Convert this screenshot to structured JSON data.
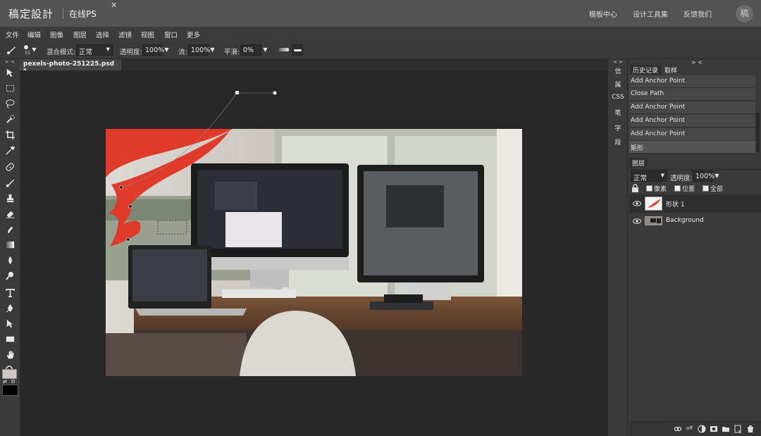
{
  "header": {
    "brand": "稿定設計",
    "product": "在线PS",
    "links": [
      "模板中心",
      "设计工具集",
      "反馈我们"
    ],
    "avatar_char": "稿"
  },
  "menu": [
    "文件",
    "编辑",
    "图像",
    "图层",
    "选择",
    "滤镜",
    "视图",
    "窗口",
    "更多"
  ],
  "options": {
    "brush_size": "15",
    "blend_label": "混合模式:",
    "blend_value": "正常",
    "opacity_label": "透明度:",
    "opacity_value": "100%",
    "flow_label": "流:",
    "flow_value": "100%",
    "smooth_label": "平滑:",
    "smooth_value": "0%"
  },
  "document": {
    "tab_label": "pexels-photo-251225.psd *",
    "close_glyph": "✕"
  },
  "side_strip": [
    "信",
    "属",
    "CSS",
    "笔",
    "字",
    "段"
  ],
  "panel_toggles": {
    "left": "> <",
    "strip": "< >",
    "right": "> <"
  },
  "history": {
    "tabs": [
      "历史记录",
      "取样"
    ],
    "items": [
      "Add Anchor Point",
      "Close Path",
      "Add Anchor Point",
      "Add Anchor Point",
      "Add Anchor Point",
      "矩形"
    ]
  },
  "layers": {
    "tab": "图层",
    "blend_value": "正常",
    "opacity_label": "透明度:",
    "opacity_value": "100%",
    "lock_options": [
      "像素",
      "位置",
      "全部"
    ],
    "items": [
      {
        "name": "形状 1",
        "selected": true
      },
      {
        "name": "Background",
        "selected": false
      }
    ],
    "bottom_text": "off"
  },
  "colors": {
    "foreground": "#d0c7c6",
    "background": "#000000",
    "shape_fill": "#e03a2a"
  }
}
